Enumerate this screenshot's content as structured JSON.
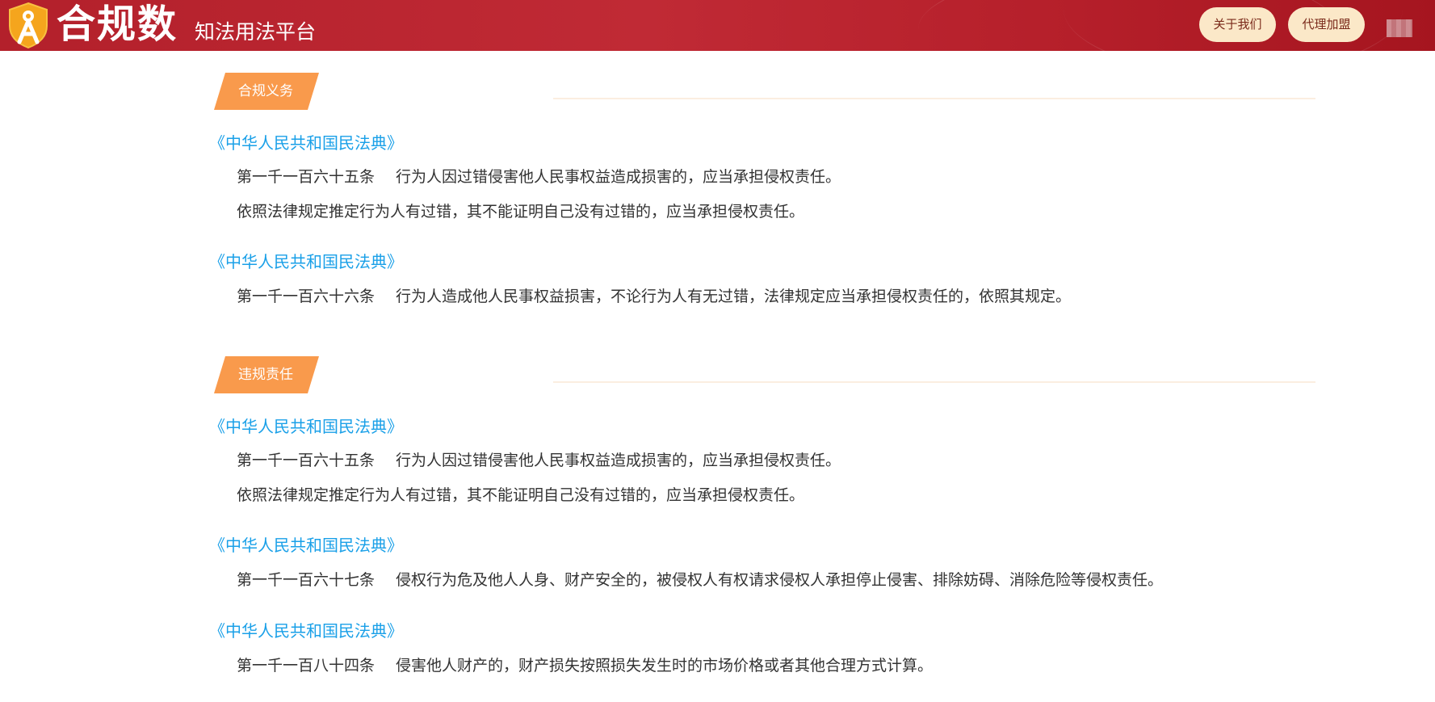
{
  "header": {
    "logo_text": "合规数",
    "subtitle": "知法用法平台",
    "about_label": "关于我们",
    "agent_label": "代理加盟",
    "accent_color": "#b3202b",
    "logo_icon": "compass-shield-icon"
  },
  "sections": [
    {
      "tag": "合规义务",
      "entries": [
        {
          "law": "《中华人民共和国民法典》",
          "lines": [
            {
              "article": "第一千一百六十五条",
              "text": "行为人因过错侵害他人民事权益造成损害的，应当承担侵权责任。"
            },
            {
              "article": "",
              "text": "依照法律规定推定行为人有过错，其不能证明自己没有过错的，应当承担侵权责任。"
            }
          ]
        },
        {
          "law": "《中华人民共和国民法典》",
          "lines": [
            {
              "article": "第一千一百六十六条",
              "text": "行为人造成他人民事权益损害，不论行为人有无过错，法律规定应当承担侵权责任的，依照其规定。"
            }
          ]
        }
      ]
    },
    {
      "tag": "违规责任",
      "entries": [
        {
          "law": "《中华人民共和国民法典》",
          "lines": [
            {
              "article": "第一千一百六十五条",
              "text": "行为人因过错侵害他人民事权益造成损害的，应当承担侵权责任。"
            },
            {
              "article": "",
              "text": "依照法律规定推定行为人有过错，其不能证明自己没有过错的，应当承担侵权责任。"
            }
          ]
        },
        {
          "law": "《中华人民共和国民法典》",
          "lines": [
            {
              "article": "第一千一百六十七条",
              "text": "侵权行为危及他人人身、财产安全的，被侵权人有权请求侵权人承担停止侵害、排除妨碍、消除危险等侵权责任。"
            }
          ]
        },
        {
          "law": "《中华人民共和国民法典》",
          "lines": [
            {
              "article": "第一千一百八十四条",
              "text": "侵害他人财产的，财产损失按照损失发生时的市场价格或者其他合理方式计算。"
            }
          ]
        }
      ]
    }
  ],
  "colors": {
    "tag_orange": "#f99a4c",
    "link_blue": "#1aa0e8",
    "body_text": "#333333"
  }
}
